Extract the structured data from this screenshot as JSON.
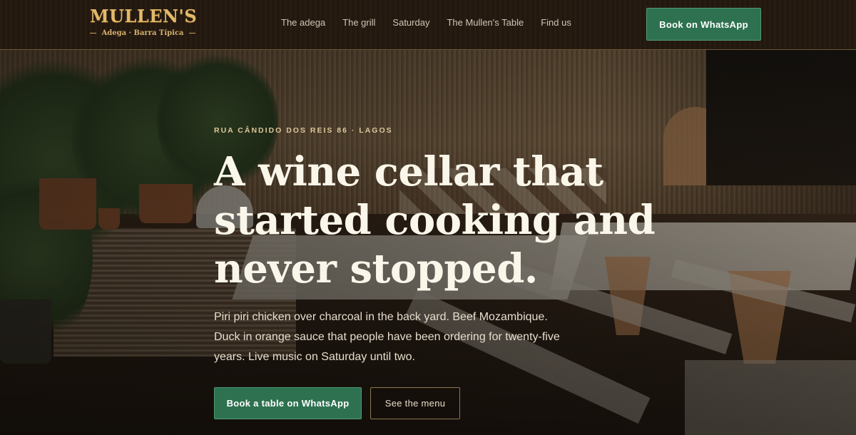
{
  "header": {
    "logo_title": "MULLEN'S",
    "logo_subtitle": "Adega · Barra Típica",
    "nav": [
      "The adega",
      "The grill",
      "Saturday",
      "The Mullen's Table",
      "Find us"
    ],
    "cta_label": "Book on WhatsApp"
  },
  "hero": {
    "eyebrow": "RUA CÂNDIDO DOS REIS 86 · LAGOS",
    "headline_lines": [
      "A wine cellar that",
      "started cooking and",
      "never stopped."
    ],
    "lede": "Piri piri chicken over charcoal in the back yard. Beef Mozambique. Duck in orange sauce that people have been ordering for twenty-five years. Live music on Saturday until two.",
    "primary_cta": "Book a table on WhatsApp",
    "secondary_cta": "See the menu"
  },
  "colors": {
    "header_bg": "#24190f",
    "gold": "#e2b96a",
    "whatsapp_green": "#2e7150",
    "headline": "#fbf6ea"
  }
}
